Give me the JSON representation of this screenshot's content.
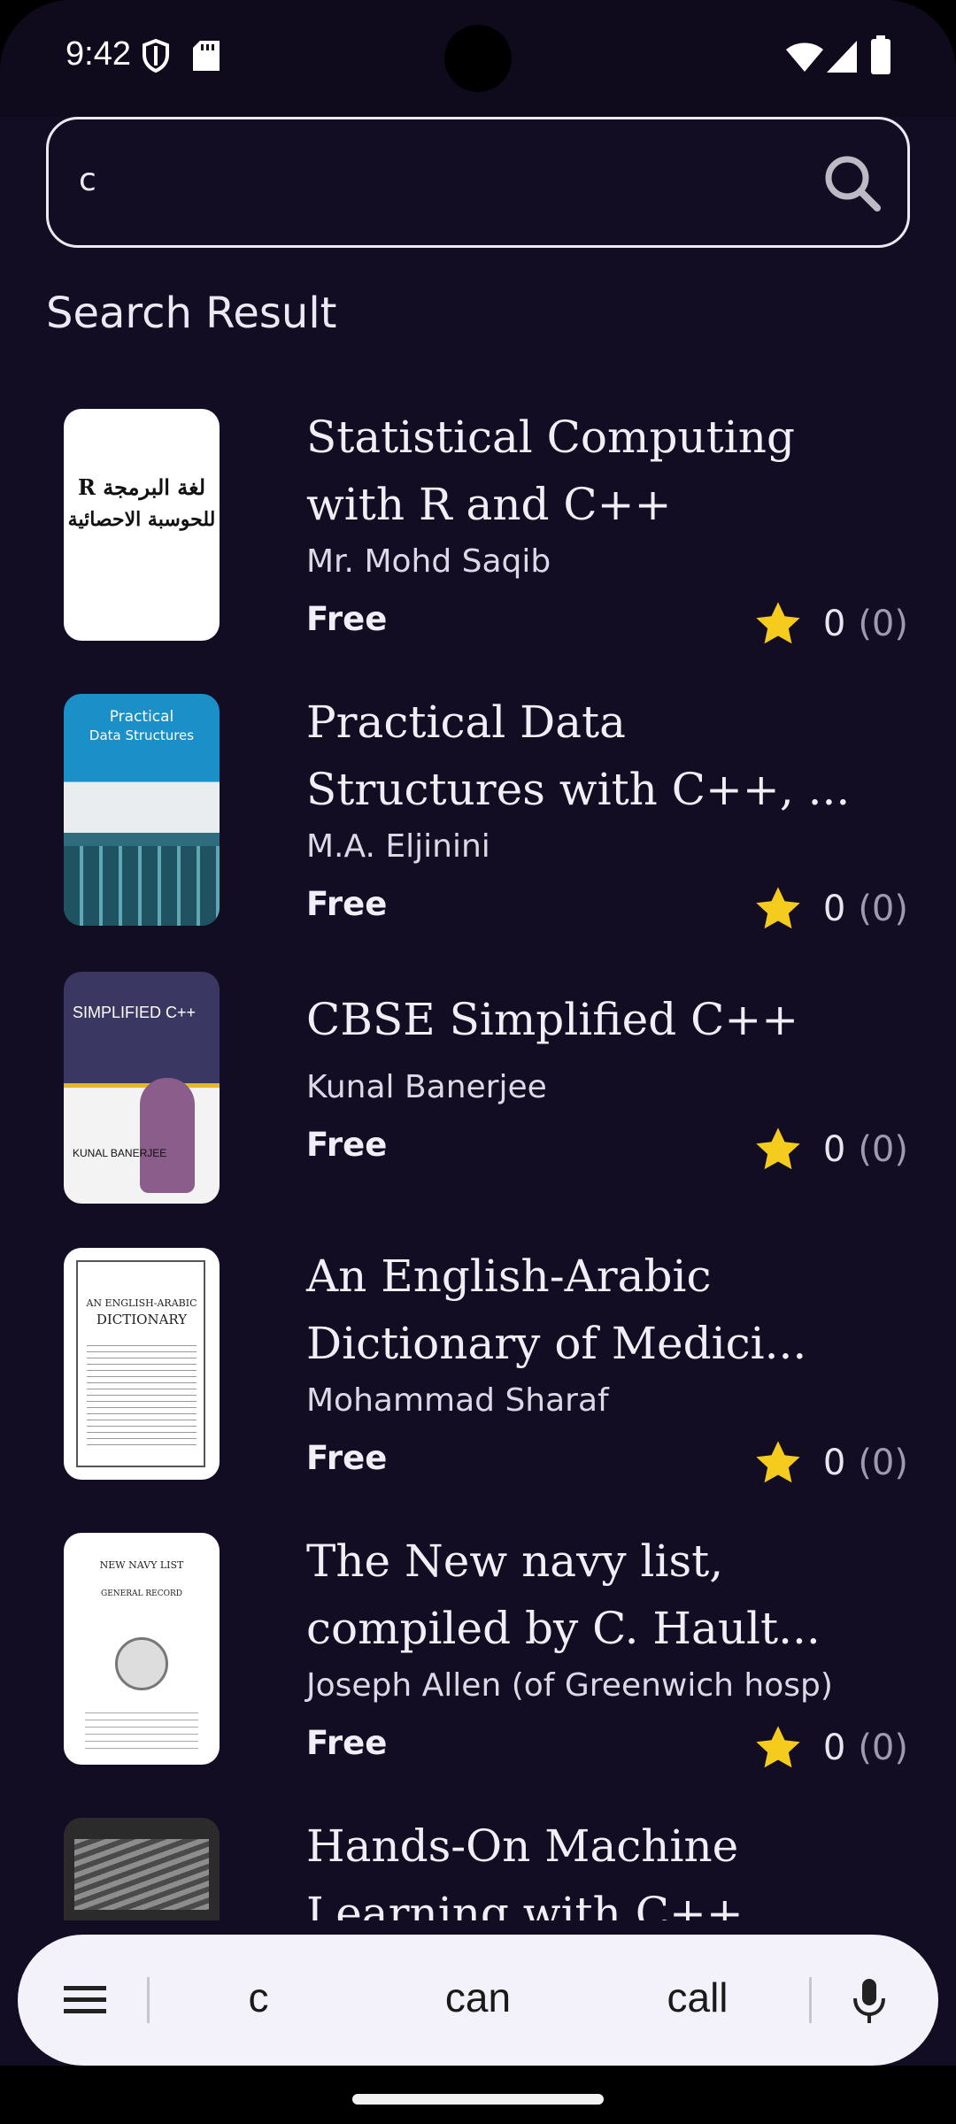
{
  "status_bar": {
    "time": "9:42",
    "icons": [
      "shield-icon",
      "sd-card-icon",
      "wifi-icon",
      "signal-icon",
      "battery-icon"
    ]
  },
  "search": {
    "value": "c",
    "icon": "search-icon"
  },
  "section_title": "Search Result",
  "books": [
    {
      "title_line1": "Statistical Computing",
      "title_line2": "with R and C++",
      "author": "Mr. Mohd Saqib",
      "price": "Free",
      "rating": "0",
      "rating_count": "(0)",
      "cover_line1": "R لغة البرمجة",
      "cover_line2": "للحوسبة الاحصائية"
    },
    {
      "title_line1": "Practical Data",
      "title_line2": "Structures with C++, ...",
      "author": "M.A. Eljinini",
      "price": "Free",
      "rating": "0",
      "rating_count": "(0)",
      "cover_line1": "Practical",
      "cover_line2": "Data Structures"
    },
    {
      "title_line1": "CBSE Simplified C++",
      "title_line2": "",
      "author": "Kunal Banerjee",
      "price": "Free",
      "rating": "0",
      "rating_count": "(0)",
      "cover_line1": "SIMPLIFIED C++",
      "cover_line2": "KUNAL BANERJEE"
    },
    {
      "title_line1": "An English-Arabic",
      "title_line2": "Dictionary of Medici...",
      "author": "Mohammad Sharaf",
      "price": "Free",
      "rating": "0",
      "rating_count": "(0)",
      "cover_line1": "AN ENGLISH-ARABIC",
      "cover_line2": "DICTIONARY"
    },
    {
      "title_line1": "The New navy list,",
      "title_line2": "compiled by C. Hault...",
      "author": "Joseph Allen (of Greenwich hosp)",
      "price": "Free",
      "rating": "0",
      "rating_count": "(0)",
      "cover_line1": "NEW NAVY LIST",
      "cover_line2": "GENERAL RECORD"
    },
    {
      "title_line1": "Hands-On Machine",
      "title_line2": "Learning with C++",
      "author": "",
      "price": "",
      "rating": "",
      "rating_count": "",
      "cover_line1": "",
      "cover_line2": ""
    }
  ],
  "keyboard": {
    "suggestions": [
      "c",
      "can",
      "call"
    ],
    "icons": [
      "menu-icon",
      "mic-icon"
    ]
  },
  "colors": {
    "background": "#120d23",
    "star": "#f5cc1e",
    "text": "#f1eef8"
  }
}
